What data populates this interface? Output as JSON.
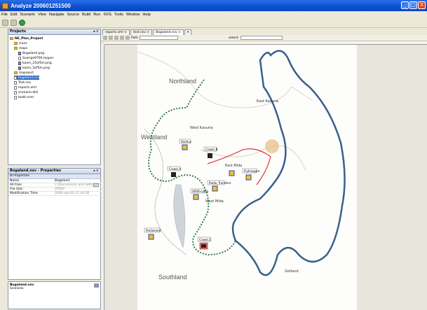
{
  "window": {
    "title": "Analyze 200601251500",
    "controls": [
      "_",
      "□",
      "X"
    ]
  },
  "menu": [
    "File",
    "Edit",
    "Scenario",
    "View",
    "Navigate",
    "Source",
    "Build",
    "Run",
    "SVG",
    "Tools",
    "Window",
    "Help"
  ],
  "projects": {
    "title": "Projects",
    "items": [
      {
        "label": "NE_Plan_Project",
        "icon": "folder",
        "bold": true
      },
      {
        "label": "icons",
        "icon": "folder"
      },
      {
        "label": "maps",
        "icon": "folder"
      },
      {
        "label": "Bogaland.png",
        "icon": "image"
      },
      {
        "label": "Sverige9700.maper",
        "icon": "file"
      },
      {
        "label": "koars_25of5m.png",
        "icon": "image"
      },
      {
        "label": "koars_5of5m.png",
        "icon": "image"
      },
      {
        "label": "mapeject",
        "icon": "folder"
      },
      {
        "label": "bogaland.nsv",
        "icon": "file",
        "selected": true
      },
      {
        "label": "Test.nsv",
        "icon": "file"
      },
      {
        "label": "reports.xml",
        "icon": "file"
      },
      {
        "label": "scenario.dtd",
        "icon": "file"
      },
      {
        "label": "bodk.nsm",
        "icon": "file"
      }
    ]
  },
  "properties": {
    "title": "Bogaland.nsv - Properties",
    "section": "Properties",
    "rows": [
      {
        "name": "Name",
        "value": "Bogaland"
      },
      {
        "name": "All Files",
        "value": "C:\\Documents and Settings\\..."
      },
      {
        "name": "File Size",
        "value": "29502"
      },
      {
        "name": "Modification Time",
        "value": "2006-apr-02 17:44:26"
      }
    ]
  },
  "status_panel": {
    "title": "Bogaland.nsv",
    "subtitle": "Scenario"
  },
  "editor_tabs": [
    "reports.xml",
    "test.nsv",
    "Bogaland.nsv"
  ],
  "map_toolbar": {
    "layer_label": "Path",
    "select_label": "select:"
  },
  "map": {
    "regions": [
      "Northland",
      "Westland",
      "Southland",
      "West Kasuria",
      "East Kasuria",
      "West Mida",
      "Gotland"
    ],
    "units": [
      "Stalhus",
      "Crowd_B",
      "Crowd_A",
      "East Mida",
      "Flyhangare",
      "Radio_Transfers",
      "SPOR-camp",
      "Parliament",
      "Crowd_C"
    ],
    "colors": {
      "border": "#2e7d4f",
      "coast": "#3a5f8a",
      "road": "#e03030",
      "city": "#e8b070"
    }
  }
}
